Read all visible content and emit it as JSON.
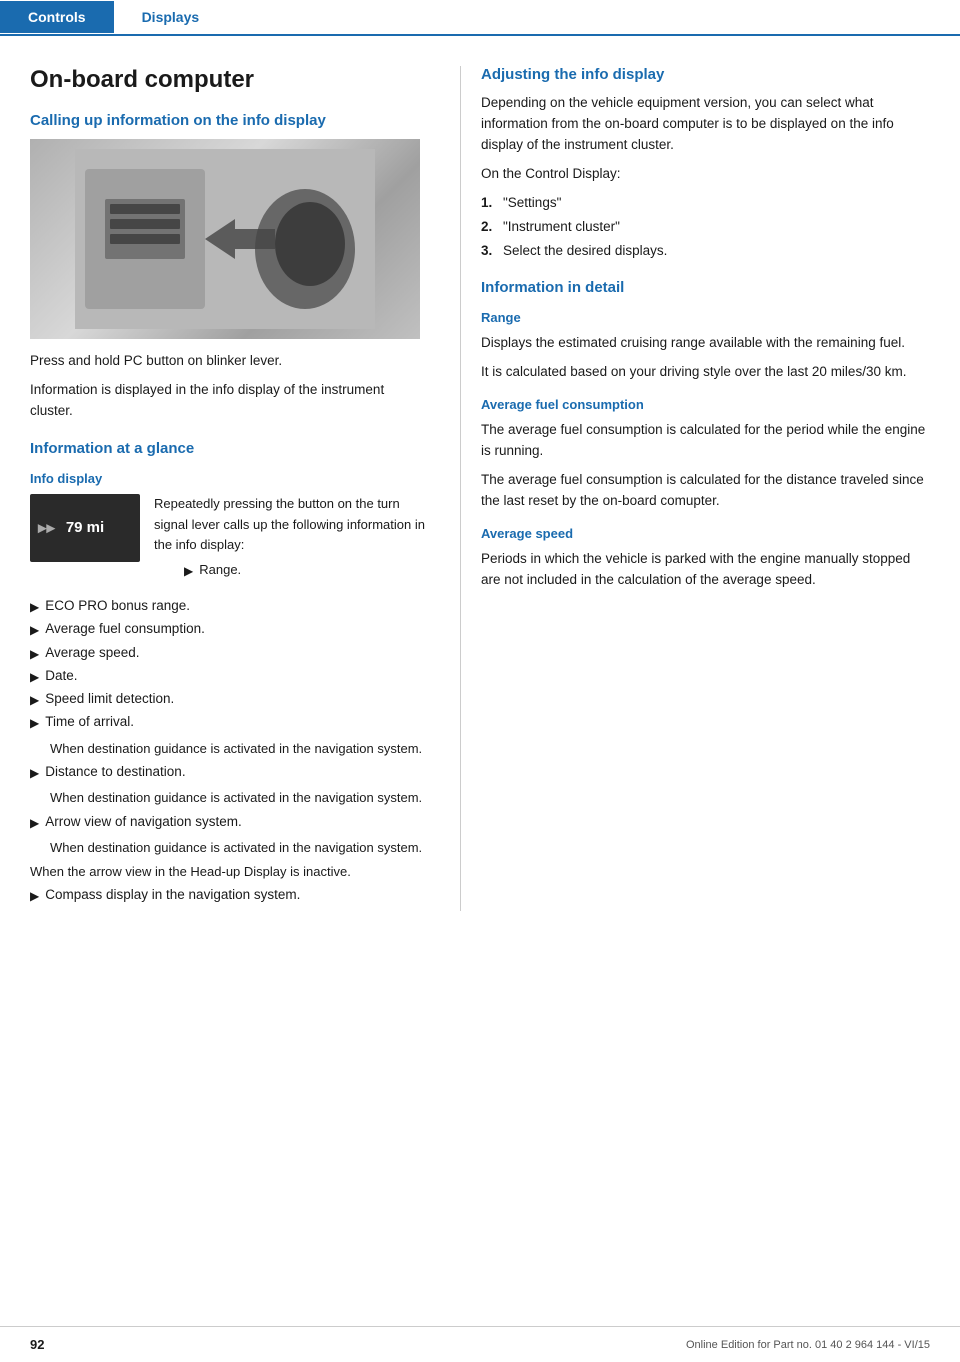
{
  "nav": {
    "tabs": [
      {
        "label": "Controls",
        "active": true
      },
      {
        "label": "Displays",
        "active": false
      }
    ]
  },
  "page": {
    "title": "On-board computer",
    "left": {
      "section1_heading": "Calling up information on the info display",
      "para1": "Press and hold PC button on blinker lever.",
      "para2": "Information is displayed in the info display of the instrument cluster.",
      "section2_heading": "Information at a glance",
      "sub_heading1": "Info display",
      "widget": {
        "arrow": "▶▶",
        "value": "79 mi"
      },
      "widget_caption": "Repeatedly pressing the button on the turn signal lever calls up the following information in the info display:",
      "widget_sub_bullet": "Range.",
      "bullets": [
        "ECO PRO bonus range.",
        "Average fuel consumption.",
        "Average speed.",
        "Date.",
        "Speed limit detection.",
        "Time of arrival."
      ],
      "time_of_arrival_sub": "When destination guidance is activated in the navigation system.",
      "bullet_distance": "Distance to destination.",
      "distance_sub": "When destination guidance is activated in the navigation system.",
      "bullet_arrow_view": "Arrow view of navigation system.",
      "arrow_view_sub": "When destination guidance is activated in the navigation system.",
      "bullet_arrow_inactive": "When the arrow view in the Head-up Display is inactive.",
      "bullet_compass": "Compass display in the navigation system."
    },
    "right": {
      "section_adjusting": "Adjusting the info display",
      "adjusting_para1": "Depending on the vehicle equipment version, you can select what information from the on-board computer is to be displayed on the info display of the instrument cluster.",
      "adjusting_para2": "On the Control Display:",
      "adjusting_steps": [
        {
          "num": "1.",
          "text": "\"Settings\""
        },
        {
          "num": "2.",
          "text": "\"Instrument cluster\""
        },
        {
          "num": "3.",
          "text": "Select the desired displays."
        }
      ],
      "section_detail": "Information in detail",
      "sub_range": "Range",
      "range_para1": "Displays the estimated cruising range available with the remaining fuel.",
      "range_para2": "It is calculated based on your driving style over the last 20 miles/30 km.",
      "sub_avg_fuel": "Average fuel consumption",
      "avg_fuel_para1": "The average fuel consumption is calculated for the period while the engine is running.",
      "avg_fuel_para2": "The average fuel consumption is calculated for the distance traveled since the last reset by the on-board comupter.",
      "sub_avg_speed": "Average speed",
      "avg_speed_para1": "Periods in which the vehicle is parked with the engine manually stopped are not included in the calculation of the average speed."
    }
  },
  "footer": {
    "page_number": "92",
    "info": "Online Edition for Part no. 01 40 2 964 144 - VI/15"
  }
}
